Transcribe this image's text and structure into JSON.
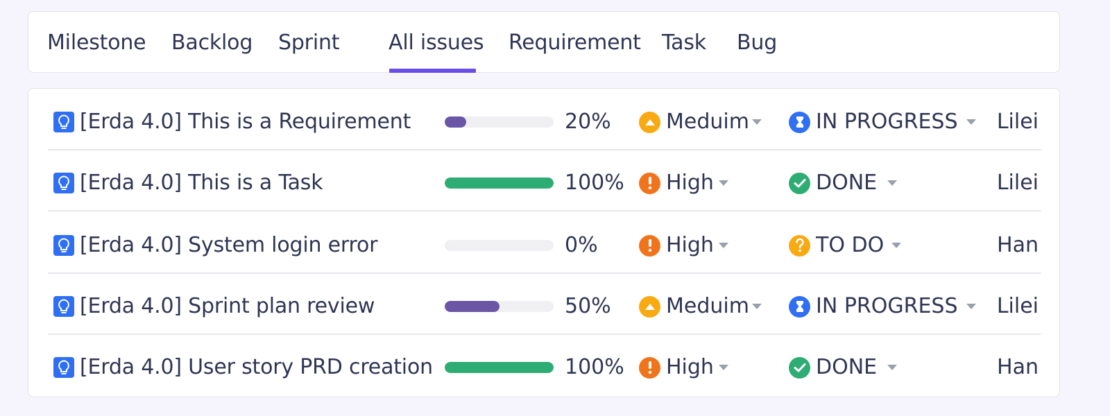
{
  "tabs": [
    {
      "label": "Milestone",
      "active": false
    },
    {
      "label": "Backlog",
      "active": false
    },
    {
      "label": "Sprint",
      "active": false
    },
    {
      "label": "All issues",
      "active": true
    },
    {
      "label": "Requirement",
      "active": false
    },
    {
      "label": "Task",
      "active": false
    },
    {
      "label": "Bug",
      "active": false
    }
  ],
  "colors": {
    "accent": "#6a4de8",
    "type_icon": "#2f6ff3",
    "progress_in_progress": "#6b55a5",
    "progress_done": "#2dac73",
    "priority_medium": "#f9a912",
    "priority_high": "#f0741b",
    "status_in_progress": "#2f6ff3",
    "status_done": "#2dac73",
    "status_todo": "#f9a912"
  },
  "issues": [
    {
      "type_icon": "lightbulb-icon",
      "title": "[Erda 4.0] This is a Requirement",
      "progress": 0.2,
      "progress_text": "20%",
      "priority": "Meduim",
      "priority_icon": "priority-medium-icon",
      "status": "IN PROGRESS",
      "status_icon": "hourglass-icon",
      "assignee": "Lilei"
    },
    {
      "type_icon": "lightbulb-icon",
      "title": "[Erda 4.0] This is a Task",
      "progress": 1.0,
      "progress_text": "100%",
      "priority": "High",
      "priority_icon": "priority-high-icon",
      "status": "DONE",
      "status_icon": "check-circle-icon",
      "assignee": "Lilei"
    },
    {
      "type_icon": "lightbulb-icon",
      "title": "[Erda 4.0] System login error",
      "progress": 0.0,
      "progress_text": "0%",
      "priority": "High",
      "priority_icon": "priority-high-icon",
      "status": "TO DO",
      "status_icon": "question-circle-icon",
      "assignee": "Han"
    },
    {
      "type_icon": "lightbulb-icon",
      "title": "[Erda 4.0] Sprint plan review",
      "progress": 0.5,
      "progress_text": "50%",
      "priority": "Meduim",
      "priority_icon": "priority-medium-icon",
      "status": "IN PROGRESS",
      "status_icon": "hourglass-icon",
      "assignee": "Lilei"
    },
    {
      "type_icon": "lightbulb-icon",
      "title": "[Erda 4.0] User story PRD creation",
      "progress": 1.0,
      "progress_text": "100%",
      "priority": "High",
      "priority_icon": "priority-high-icon",
      "status": "DONE",
      "status_icon": "check-circle-icon",
      "assignee": "Han"
    }
  ]
}
